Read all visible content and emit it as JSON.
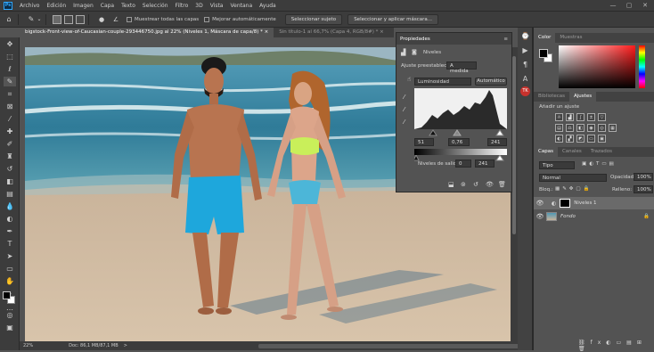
{
  "app": {
    "logo": "Ps"
  },
  "menu": [
    "Archivo",
    "Edición",
    "Imagen",
    "Capa",
    "Texto",
    "Selección",
    "Filtro",
    "3D",
    "Vista",
    "Ventana",
    "Ayuda"
  ],
  "window_controls": {
    "minimize": "—",
    "restore": "▢",
    "close": "✕"
  },
  "options_bar": {
    "sample_all_layers": "Muestrear todas las capas",
    "auto_enhance": "Mejorar automáticamente",
    "select_subject": "Seleccionar sujeto",
    "select_and_mask": "Seleccionar y aplicar máscara..."
  },
  "doc_tabs": [
    {
      "label": "bigstock-Front-view-of-Caucasian-couple-293446750.jpg al 22% (Niveles 1, Máscara de capa/8) *",
      "close": "×"
    },
    {
      "label": "Sin título-1 al 66,7% (Capa 4, RGB/8#) *",
      "close": "×"
    }
  ],
  "status": {
    "zoom": "22%",
    "doc": "Doc: 86,1 MB/87,1 MB",
    "arrow": ">"
  },
  "properties": {
    "title": "Propiedades",
    "subtitle": "Niveles",
    "preset_label": "Ajuste preestablecido:",
    "preset_value": "A medida",
    "channel": "Luminosidad",
    "auto": "Automático",
    "input_black": "51",
    "input_gamma": "0,76",
    "input_white": "241",
    "output_label": "Niveles de salida:",
    "output_black": "0",
    "output_white": "241"
  },
  "color_panel": {
    "tabs": [
      "Color",
      "Muestras"
    ]
  },
  "adjust_panel": {
    "tabs": [
      "Bibliotecas",
      "Ajustes"
    ],
    "add_label": "Añadir un ajuste"
  },
  "layers_panel": {
    "tabs": [
      "Capas",
      "Canales",
      "Trazados"
    ],
    "kind": "Tipo",
    "blend": "Normal",
    "opacity_label": "Opacidad:",
    "opacity": "100%",
    "lock_label": "Bloq.:",
    "fill_label": "Relleno:",
    "fill": "100%",
    "layers": [
      {
        "name": "Niveles 1"
      },
      {
        "name": "Fondo"
      }
    ]
  },
  "colors": {
    "accent": "#31a8ff",
    "fg": "#000000",
    "bg": "#ffffff"
  }
}
